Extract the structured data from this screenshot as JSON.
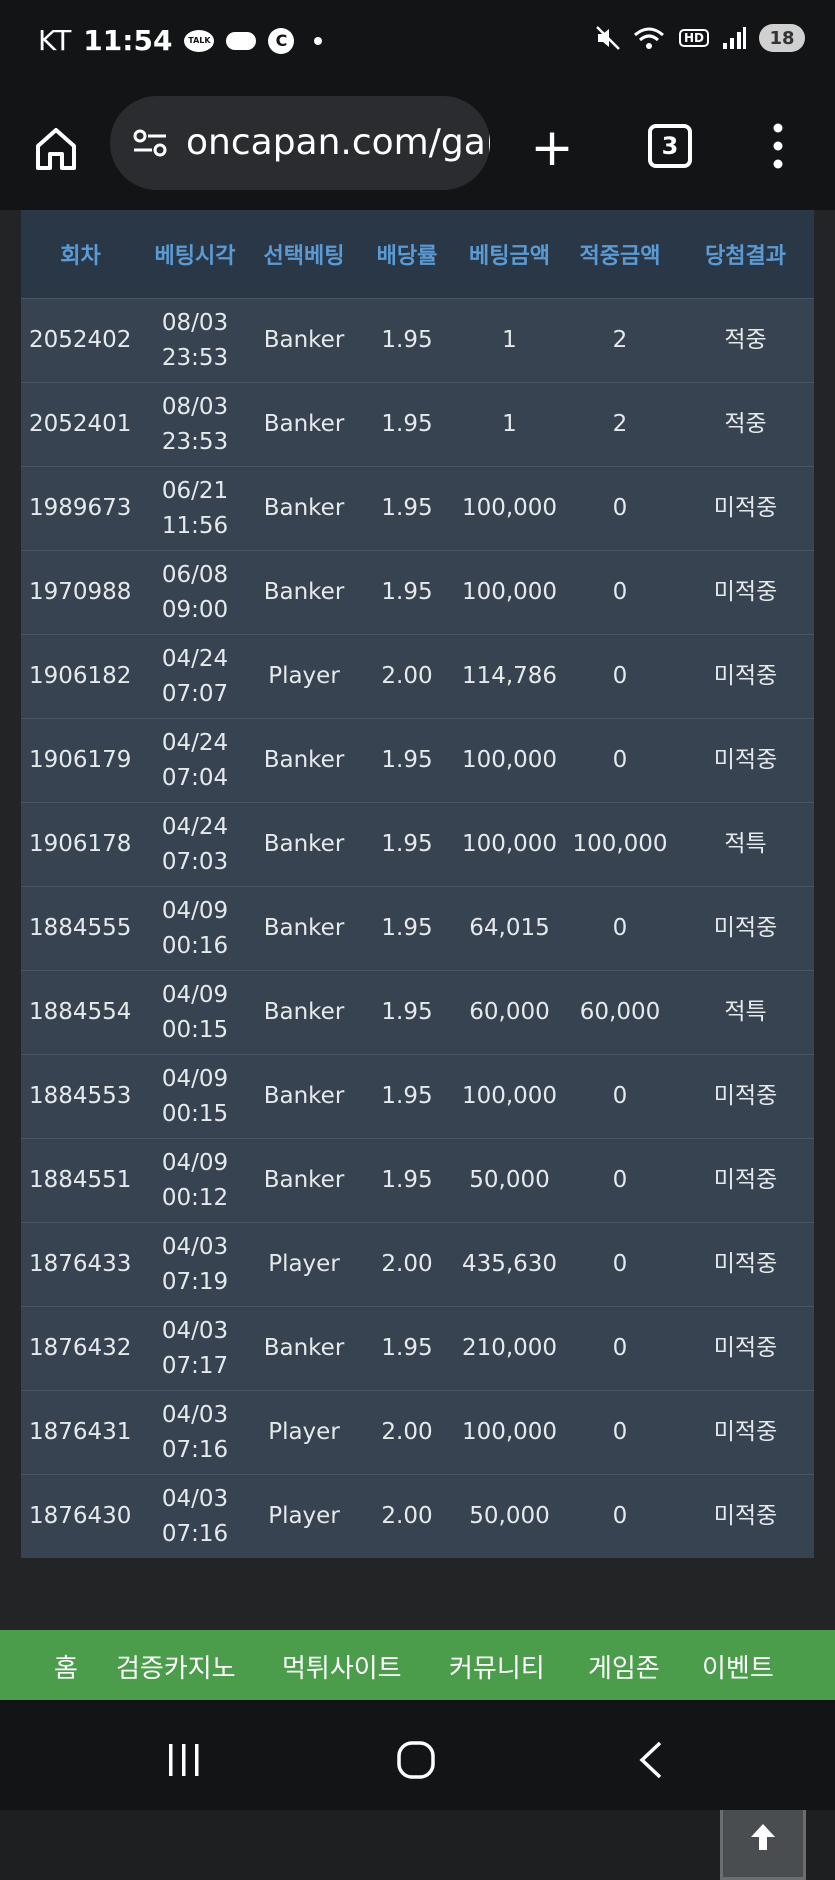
{
  "status_bar": {
    "carrier": "KT",
    "time": "11:54",
    "battery": "18"
  },
  "browser": {
    "url": "oncapan.com/gar",
    "tab_count": "3"
  },
  "table": {
    "headers": [
      "회차",
      "베팅시각",
      "선택베팅",
      "배당률",
      "베팅금액",
      "적중금액",
      "당첨결과"
    ],
    "rows": [
      {
        "round": "2052402",
        "date": "08/03",
        "time": "23:53",
        "pick": "Banker",
        "odds": "1.95",
        "bet": "1",
        "win": "2",
        "result": "적중"
      },
      {
        "round": "2052401",
        "date": "08/03",
        "time": "23:53",
        "pick": "Banker",
        "odds": "1.95",
        "bet": "1",
        "win": "2",
        "result": "적중"
      },
      {
        "round": "1989673",
        "date": "06/21",
        "time": "11:56",
        "pick": "Banker",
        "odds": "1.95",
        "bet": "100,000",
        "win": "0",
        "result": "미적중"
      },
      {
        "round": "1970988",
        "date": "06/08",
        "time": "09:00",
        "pick": "Banker",
        "odds": "1.95",
        "bet": "100,000",
        "win": "0",
        "result": "미적중"
      },
      {
        "round": "1906182",
        "date": "04/24",
        "time": "07:07",
        "pick": "Player",
        "odds": "2.00",
        "bet": "114,786",
        "win": "0",
        "result": "미적중"
      },
      {
        "round": "1906179",
        "date": "04/24",
        "time": "07:04",
        "pick": "Banker",
        "odds": "1.95",
        "bet": "100,000",
        "win": "0",
        "result": "미적중"
      },
      {
        "round": "1906178",
        "date": "04/24",
        "time": "07:03",
        "pick": "Banker",
        "odds": "1.95",
        "bet": "100,000",
        "win": "100,000",
        "result": "적특"
      },
      {
        "round": "1884555",
        "date": "04/09",
        "time": "00:16",
        "pick": "Banker",
        "odds": "1.95",
        "bet": "64,015",
        "win": "0",
        "result": "미적중"
      },
      {
        "round": "1884554",
        "date": "04/09",
        "time": "00:15",
        "pick": "Banker",
        "odds": "1.95",
        "bet": "60,000",
        "win": "60,000",
        "result": "적특"
      },
      {
        "round": "1884553",
        "date": "04/09",
        "time": "00:15",
        "pick": "Banker",
        "odds": "1.95",
        "bet": "100,000",
        "win": "0",
        "result": "미적중"
      },
      {
        "round": "1884551",
        "date": "04/09",
        "time": "00:12",
        "pick": "Banker",
        "odds": "1.95",
        "bet": "50,000",
        "win": "0",
        "result": "미적중"
      },
      {
        "round": "1876433",
        "date": "04/03",
        "time": "07:19",
        "pick": "Player",
        "odds": "2.00",
        "bet": "435,630",
        "win": "0",
        "result": "미적중"
      },
      {
        "round": "1876432",
        "date": "04/03",
        "time": "07:17",
        "pick": "Banker",
        "odds": "1.95",
        "bet": "210,000",
        "win": "0",
        "result": "미적중"
      },
      {
        "round": "1876431",
        "date": "04/03",
        "time": "07:16",
        "pick": "Player",
        "odds": "2.00",
        "bet": "100,000",
        "win": "0",
        "result": "미적중"
      },
      {
        "round": "1876430",
        "date": "04/03",
        "time": "07:16",
        "pick": "Player",
        "odds": "2.00",
        "bet": "50,000",
        "win": "0",
        "result": "미적중"
      }
    ]
  },
  "footer_nav": [
    "홈",
    "검증카지노",
    "먹튀사이트",
    "커뮤니티",
    "게임존",
    "이벤트"
  ],
  "colors": {
    "header_text": "#5b9bd5",
    "row_bg": "#374350",
    "win_color": "#f0c040",
    "lose_color": "#e84a4a",
    "footer_bg": "#4b9d4c"
  }
}
